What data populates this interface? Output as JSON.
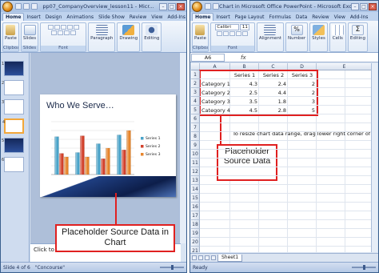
{
  "ppt": {
    "office_button": "office-button",
    "title": "pp07_CompanyOverview_lesson11 - Micr...",
    "tabs": [
      "Home",
      "Insert",
      "Design",
      "Animations",
      "Slide Show",
      "Review",
      "View",
      "Add-Ins"
    ],
    "ribbon": {
      "clipboard": {
        "paste": "Paste",
        "group": "Clipboard"
      },
      "slides": {
        "label": "Slides",
        "group": "Slides"
      },
      "font": {
        "group": "Font"
      },
      "paragraph": {
        "label": "Paragraph"
      },
      "drawing": {
        "label": "Drawing"
      },
      "editing": {
        "label": "Editing"
      }
    },
    "slide_thumbnails": [
      "1",
      "2",
      "3",
      "4",
      "5",
      "6"
    ],
    "slide_title": "Who We Serve…",
    "notes_placeholder": "Click to a",
    "status": {
      "slide": "Slide 4 of 6",
      "theme": "\"Concourse\""
    },
    "callout": "Placeholder Source Data in Chart"
  },
  "excel": {
    "title": "Chart in Microsoft Office PowerPoint - Microsoft Excel",
    "tabs": [
      "Home",
      "Insert",
      "Page Layout",
      "Formulas",
      "Data",
      "Review",
      "View",
      "Add-Ins"
    ],
    "ribbon": {
      "clipboard": {
        "paste": "Paste",
        "group": "Clipboard"
      },
      "font": {
        "name": "Calibri",
        "size": "11",
        "group": "Font"
      },
      "alignment": {
        "label": "Alignment"
      },
      "number": {
        "label": "Number"
      },
      "styles": {
        "label": "Styles"
      },
      "cells": {
        "label": "Cells"
      },
      "editing": {
        "label": "Editing"
      }
    },
    "name_box": "A6",
    "fx": "fx",
    "columns": [
      "A",
      "B",
      "C",
      "D",
      "E"
    ],
    "rows": [
      "1",
      "2",
      "3",
      "4",
      "5",
      "6",
      "7",
      "8",
      "9",
      "10",
      "11",
      "12",
      "13",
      "14",
      "15",
      "16",
      "17",
      "18",
      "19",
      "20",
      "21"
    ],
    "table": {
      "headers": [
        "",
        "Series 1",
        "Series 2",
        "Series 3"
      ],
      "rows": [
        [
          "Category 1",
          "4.3",
          "2.4",
          "2"
        ],
        [
          "Category 2",
          "2.5",
          "4.4",
          "2"
        ],
        [
          "Category 3",
          "3.5",
          "1.8",
          "3"
        ],
        [
          "Category 4",
          "4.5",
          "2.8",
          "5"
        ]
      ]
    },
    "hint": "To resize chart data range, drag lower right corner of rang",
    "sheet_tab": "Sheet1",
    "status": "Ready",
    "callout": "Placeholder Source Data"
  },
  "colors": {
    "series1": "#4aa3c9",
    "series2": "#d2412b",
    "series3": "#e7852c",
    "callout_red": "#e02020"
  },
  "chart_data": {
    "type": "bar",
    "categories": [
      "Category 1",
      "Category 2",
      "Category 3",
      "Category 4"
    ],
    "series": [
      {
        "name": "Series 1",
        "values": [
          4.3,
          2.5,
          3.5,
          4.5
        ]
      },
      {
        "name": "Series 2",
        "values": [
          2.4,
          4.4,
          1.8,
          2.8
        ]
      },
      {
        "name": "Series 3",
        "values": [
          2,
          2,
          3,
          5
        ]
      }
    ],
    "ylim": [
      0,
      6
    ],
    "legend": "right"
  }
}
